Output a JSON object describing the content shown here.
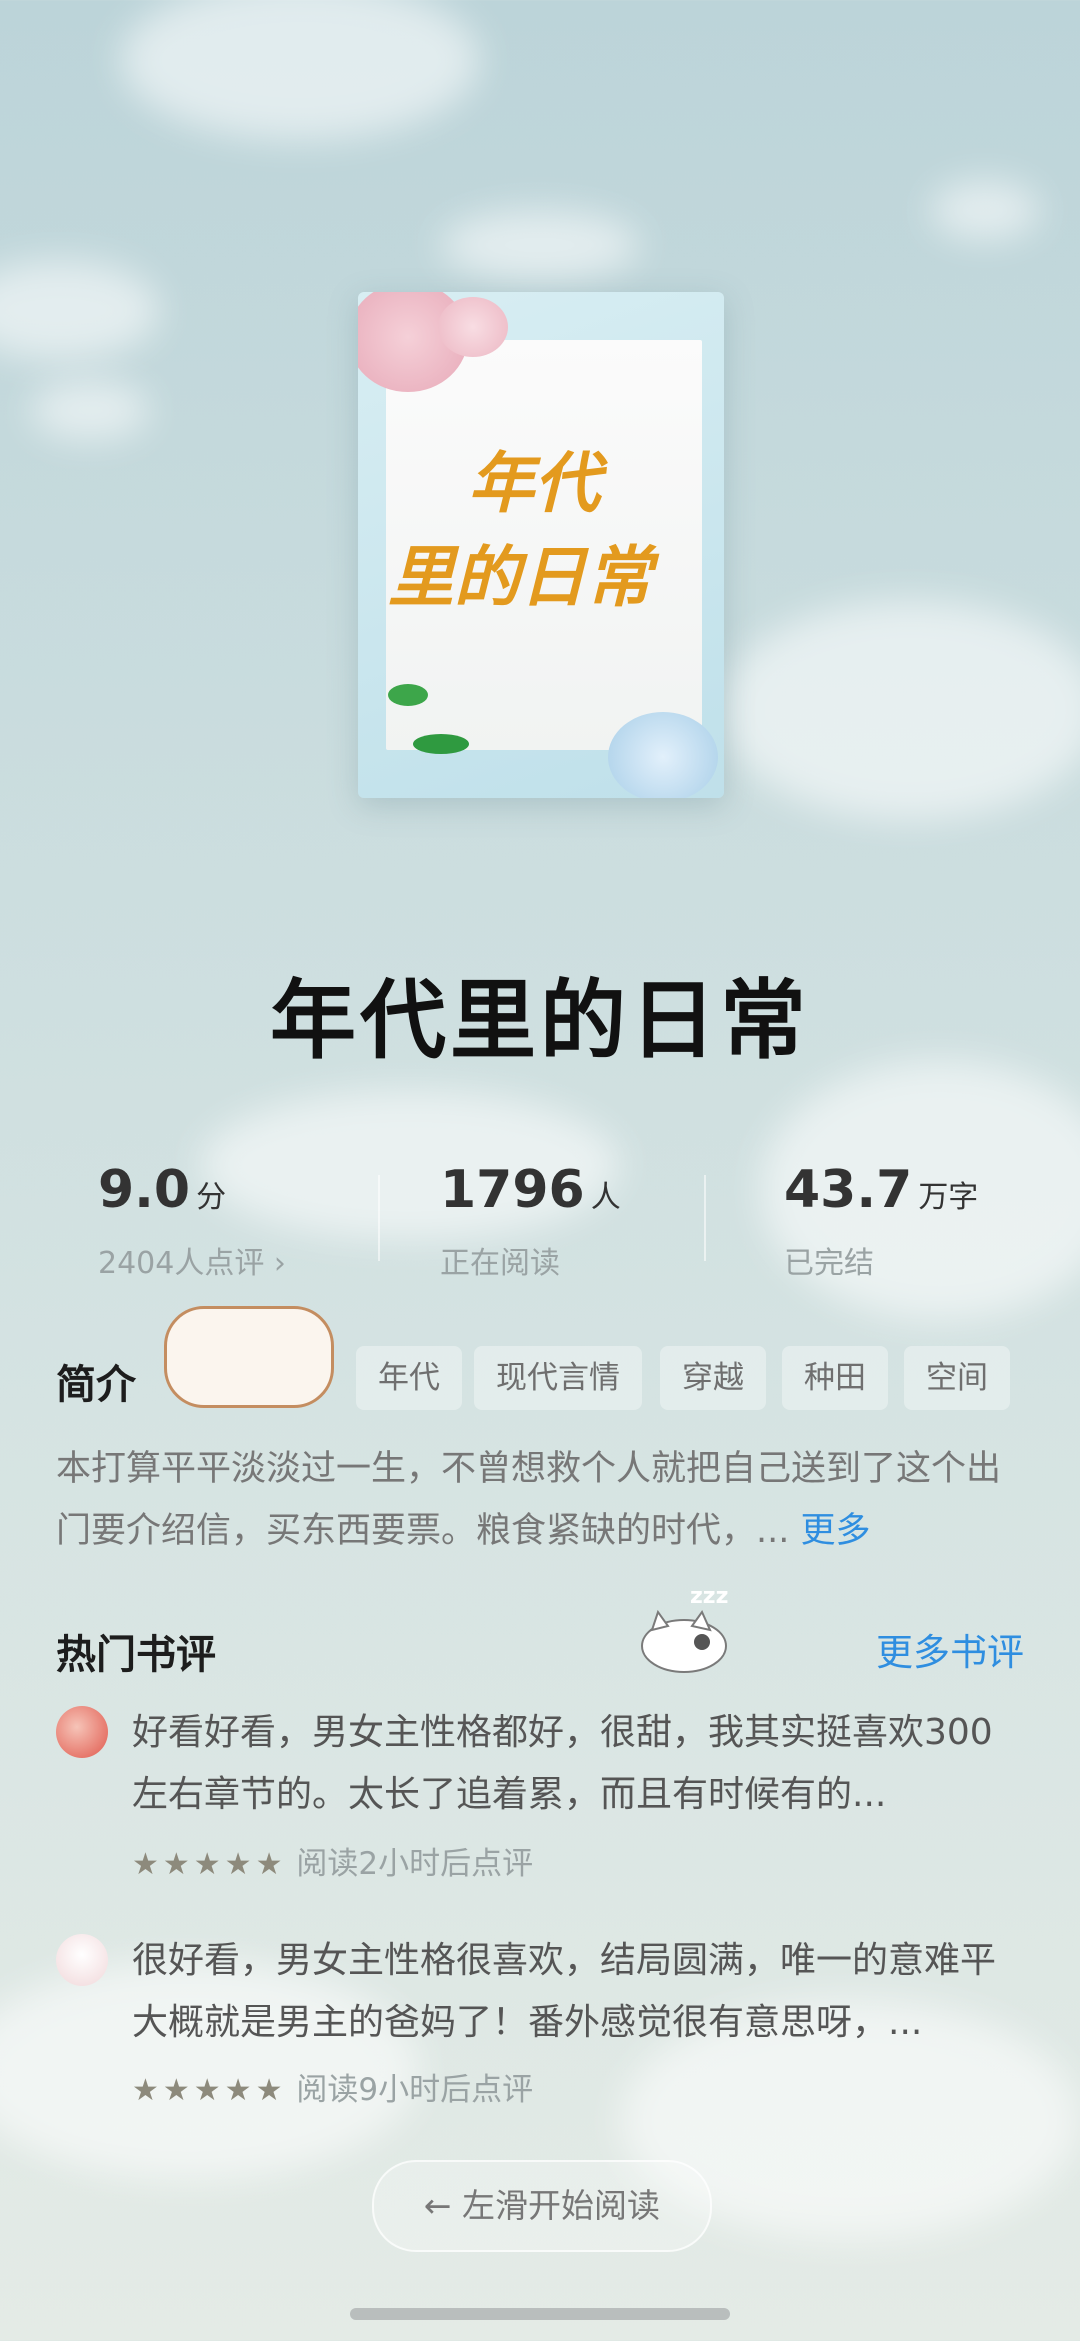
{
  "book": {
    "cover_title_line1": "年代",
    "cover_title_line2": "里的日常",
    "title": "年代里的日常"
  },
  "stats": [
    {
      "value": "9.0",
      "unit": "分",
      "sub": "2404人点评 ›"
    },
    {
      "value": "1796",
      "unit": "人",
      "sub": "正在阅读"
    },
    {
      "value": "43.7",
      "unit": "万字",
      "sub": "已完结"
    }
  ],
  "intro": {
    "label": "简介",
    "tags": [
      "年代",
      "现代言情",
      "穿越",
      "种田",
      "空间"
    ],
    "text": "本打算平平淡淡过一生，不曾想救个人就把自己送到了这个出门要介绍信，买东西要票。粮食紧缺的时代，...",
    "more": "更多"
  },
  "reviews": {
    "label": "热门书评",
    "more": "更多书评",
    "items": [
      {
        "text": "好看好看，男女主性格都好，很甜，我其实挺喜欢300左右章节的。太长了追着累，而且有时候有的...",
        "stars": "★★★★★",
        "meta": "阅读2小时后点评",
        "avatar_color": "#e0584c"
      },
      {
        "text": "很好看，男女主性格很喜欢，结局圆满，唯一的意难平大概就是男主的爸妈了！番外感觉很有意思呀，...",
        "stars": "★★★★★",
        "meta": "阅读9小时后点评",
        "avatar_color": "#f1d8da"
      }
    ]
  },
  "bottom": {
    "start_label": "← 左滑开始阅读"
  },
  "sticker_text": "zzz"
}
